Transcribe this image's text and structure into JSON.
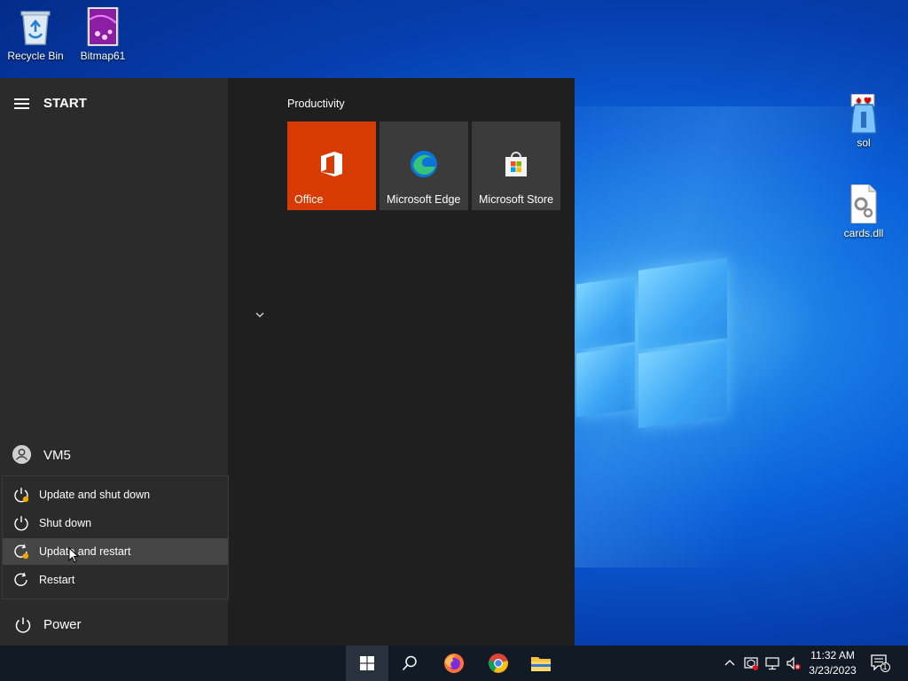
{
  "desktop": {
    "icons": [
      {
        "label": "Recycle Bin",
        "icon": "recycle-bin-icon"
      },
      {
        "label": "Bitmap61",
        "icon": "bitmap-file-icon"
      },
      {
        "label": "sol",
        "icon": "solitaire-icon"
      },
      {
        "label": "cards.dll",
        "icon": "dll-file-icon"
      }
    ]
  },
  "start_menu": {
    "title": "START",
    "user": {
      "name": "VM5"
    },
    "power_menu": {
      "items": [
        {
          "label": "Update and shut down",
          "icon": "power-update-icon"
        },
        {
          "label": "Shut down",
          "icon": "power-icon"
        },
        {
          "label": "Update and restart",
          "icon": "restart-update-icon",
          "hovered": true
        },
        {
          "label": "Restart",
          "icon": "restart-icon"
        }
      ]
    },
    "power_label": "Power",
    "group": {
      "title": "Productivity",
      "tiles": [
        {
          "label": "Office",
          "color": "#d83b01",
          "icon": "office-icon"
        },
        {
          "label": "Microsoft Edge",
          "color": "#3b3b3b",
          "icon": "edge-icon"
        },
        {
          "label": "Microsoft Store",
          "color": "#3b3b3b",
          "icon": "store-icon"
        }
      ]
    }
  },
  "taskbar": {
    "buttons": [
      {
        "name": "start-button",
        "icon": "windows-icon",
        "active": true
      },
      {
        "name": "search-button",
        "icon": "search-icon"
      },
      {
        "name": "firefox-button",
        "icon": "firefox-icon"
      },
      {
        "name": "chrome-button",
        "icon": "chrome-icon"
      },
      {
        "name": "file-explorer-button",
        "icon": "folder-icon"
      }
    ],
    "tray": {
      "time": "11:32 AM",
      "date": "3/23/2023",
      "notification_count": "1"
    }
  },
  "colors": {
    "accent": "#d83b01",
    "start_bg": "#1f1f1f",
    "start_left_bg": "#2b2b2b",
    "taskbar_bg": "#121a26"
  }
}
